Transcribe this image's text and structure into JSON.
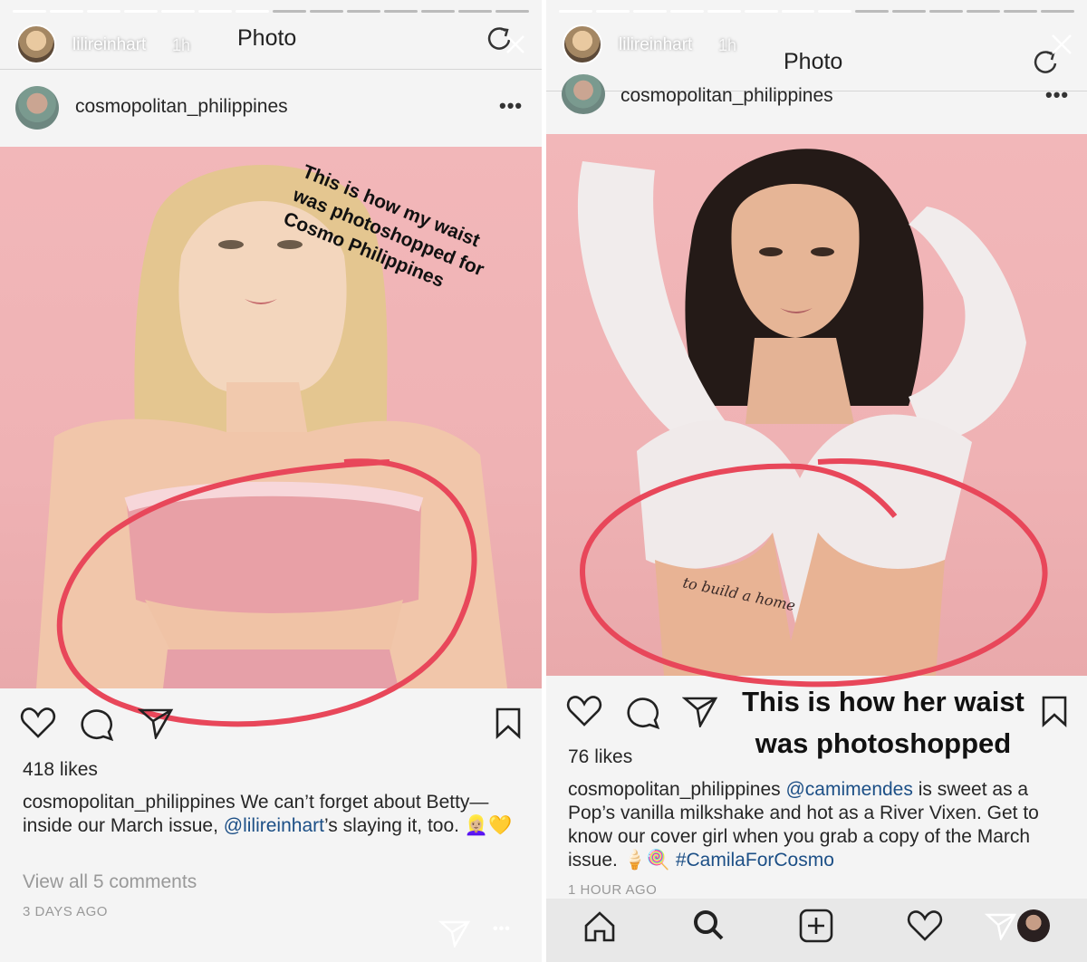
{
  "left": {
    "story": {
      "user": "lilireinhart",
      "time": "1h"
    },
    "app_title": "Photo",
    "post": {
      "username": "cosmopolitan_philippines",
      "overlay_lines": [
        "This is how my waist",
        "was photoshopped for",
        "Cosmo Philippines"
      ],
      "likes": "418 likes",
      "caption": {
        "username": "cosmopolitan_philippines",
        "text1": " We can’t forget about Betty—inside our March issue, ",
        "mention": "@lilireinhart",
        "text2": "’s slaying it, too. ",
        "emoji": "👱🏼‍♀️💛"
      },
      "view_comments": "View all 5 comments",
      "timestamp": "3 DAYS AGO"
    }
  },
  "right": {
    "story": {
      "user": "lilireinhart",
      "time": "1h"
    },
    "app_title": "Photo",
    "post": {
      "username": "cosmopolitan_philippines",
      "overlay_lines": [
        "This is how her waist",
        "was photoshopped"
      ],
      "likes": "76 likes",
      "caption": {
        "username": "cosmopolitan_philippines",
        "mention": " @camimendes",
        "text": " is sweet as a Pop’s vanilla milkshake and hot as a River Vixen. Get to know our cover girl when you grab a copy of the March issue. ",
        "emoji": "🍦🍭",
        "hashtag": " #CamilaForCosmo"
      },
      "timestamp": "1 HOUR AGO"
    }
  },
  "colors": {
    "circle": "#e8475a",
    "photo_bg": "#f0b4b6",
    "link": "#1c4f86"
  },
  "icons": [
    "heart-icon",
    "comment-icon",
    "share-icon",
    "bookmark-icon",
    "refresh-icon",
    "close-icon",
    "more-icon",
    "home-icon",
    "search-icon",
    "add-icon",
    "activity-icon",
    "direct-icon"
  ]
}
